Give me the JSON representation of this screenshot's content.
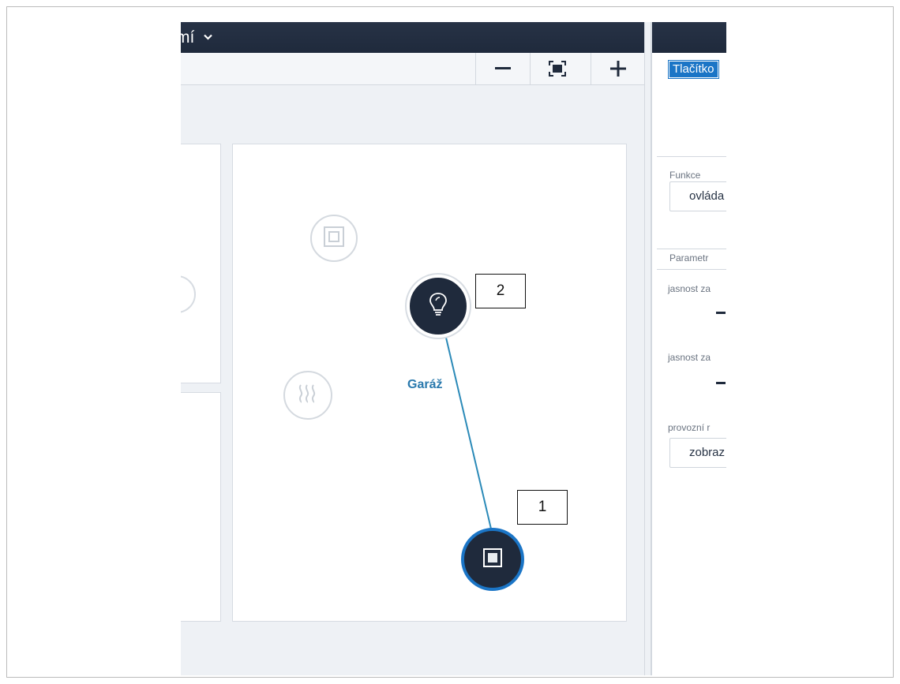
{
  "editor": {
    "title_fragment": "mí",
    "toolbar": {
      "zoom_out_icon": "minus-icon",
      "fit_icon": "fit-to-screen-icon",
      "zoom_in_icon": "plus-icon"
    },
    "room_label": "Garáž",
    "callouts": {
      "first": "1",
      "second": "2"
    },
    "nodes": {
      "switch_icon": "switch-square-icon",
      "light_icon": "light-bulb-icon",
      "heating_icon": "heating-icon"
    },
    "colors": {
      "header": "#222d40",
      "accent": "#1b75c6",
      "link": "#2b8ab8",
      "room_label": "#2979ad"
    }
  },
  "properties": {
    "header_tag": "Tlačítko",
    "funkce_label": "Funkce",
    "funkce_value": "ovláda",
    "parametr_label": "Parametr",
    "jasnost_1_label": "jasnost za",
    "jasnost_2_label": "jasnost za",
    "provozni_label": "provozní r",
    "provozni_value": "zobraz"
  }
}
